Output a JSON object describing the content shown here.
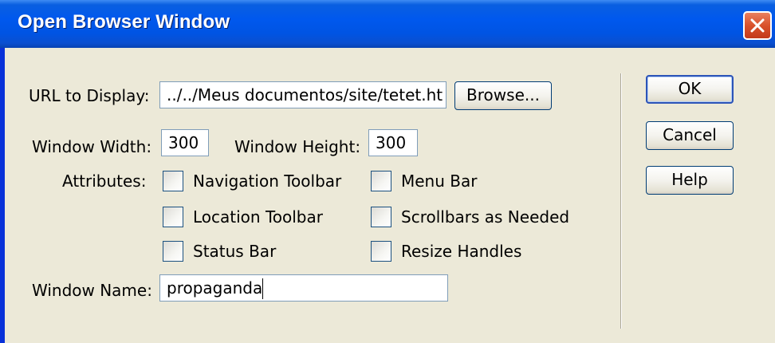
{
  "window": {
    "title": "Open Browser Window"
  },
  "fields": {
    "url": {
      "label": "URL to Display:",
      "value": "../../Meus documentos/site/tetet.ht"
    },
    "browse_label": "Browse...",
    "width": {
      "label": "Window Width:",
      "value": "300"
    },
    "height": {
      "label": "Window Height:",
      "value": "300"
    },
    "name": {
      "label": "Window Name:",
      "value": "propaganda"
    }
  },
  "attributes": {
    "label": "Attributes:",
    "items": [
      {
        "label": "Navigation Toolbar",
        "checked": false
      },
      {
        "label": "Menu Bar",
        "checked": false
      },
      {
        "label": "Location Toolbar",
        "checked": false
      },
      {
        "label": "Scrollbars as Needed",
        "checked": false
      },
      {
        "label": "Status Bar",
        "checked": false
      },
      {
        "label": "Resize Handles",
        "checked": false
      }
    ]
  },
  "buttons": {
    "ok": "OK",
    "cancel": "Cancel",
    "help": "Help"
  }
}
